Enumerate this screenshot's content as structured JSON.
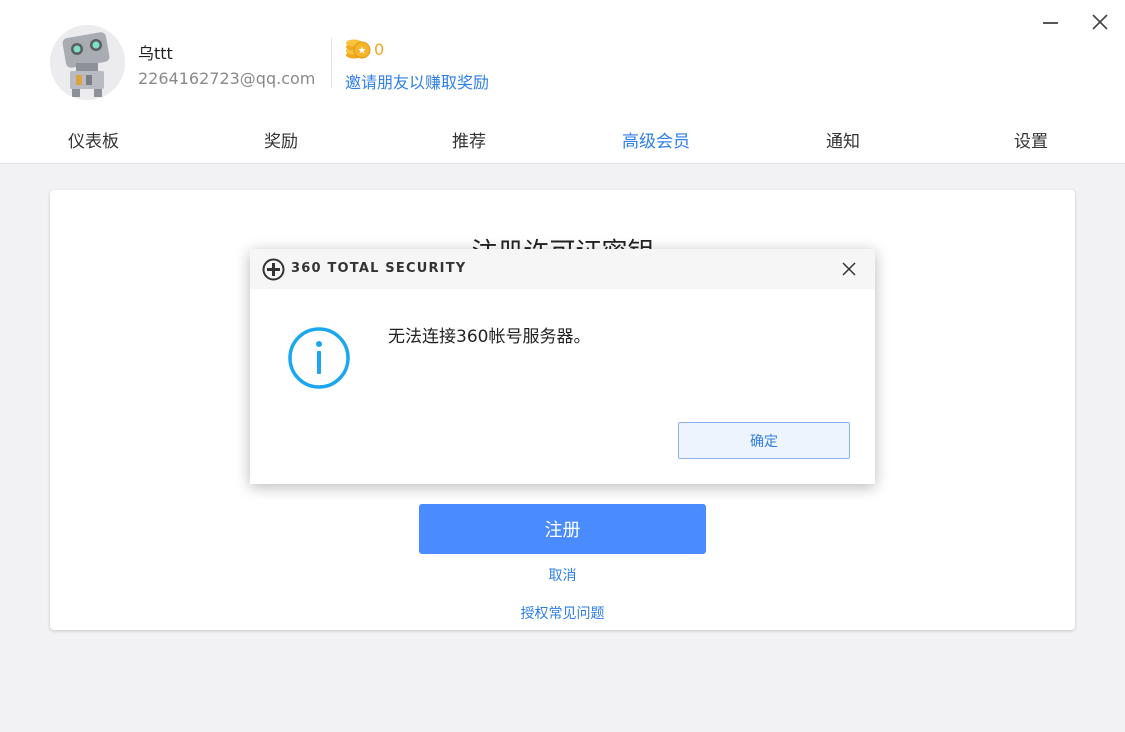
{
  "profile": {
    "username": "乌ttt",
    "email": "2264162723@qq.com",
    "coins": "0",
    "invite_link": "邀请朋友以赚取奖励"
  },
  "nav": {
    "tabs": [
      {
        "label": "仪表板",
        "active": false
      },
      {
        "label": "奖励",
        "active": false
      },
      {
        "label": "推荐",
        "active": false
      },
      {
        "label": "高级会员",
        "active": true
      },
      {
        "label": "通知",
        "active": false
      },
      {
        "label": "设置",
        "active": false
      }
    ]
  },
  "panel": {
    "title": "注册许可证密钥",
    "register_button": "注册",
    "cancel_link": "取消",
    "faq_link": "授权常见问题"
  },
  "dialog": {
    "brand": "360 TOTAL SECURITY",
    "message": "无法连接360帐号服务器。",
    "ok_button": "确定"
  },
  "colors": {
    "accent": "#2f7fe8",
    "primary_button": "#4a8cff",
    "coin": "#f5a623",
    "info_icon": "#1aa7f0"
  },
  "icons": {
    "avatar": "robot-avatar",
    "coins": "coins-icon",
    "minimize": "minimize-icon",
    "close": "close-icon",
    "dialog_logo": "360-logo-icon",
    "info": "info-icon"
  }
}
